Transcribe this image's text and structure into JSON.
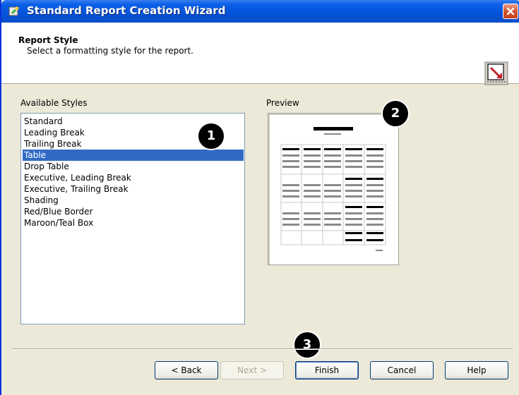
{
  "window": {
    "title": "Standard Report Creation Wizard"
  },
  "header": {
    "title": "Report Style",
    "subtitle": "Select a formatting style for the report."
  },
  "styles": {
    "label": "Available Styles",
    "items": [
      "Standard",
      "Leading Break",
      "Trailing Break",
      "Table",
      "Drop Table",
      "Executive, Leading Break",
      "Executive, Trailing Break",
      "Shading",
      "Red/Blue Border",
      "Maroon/Teal Box"
    ],
    "selected": "Table"
  },
  "preview": {
    "label": "Preview"
  },
  "callouts": {
    "one": "1",
    "two": "2",
    "three": "3"
  },
  "buttons": {
    "back": "< Back",
    "next": "Next >",
    "finish": "Finish",
    "cancel": "Cancel",
    "help": "Help"
  },
  "colors": {
    "titlebar": "#0553d9",
    "selection": "#316ac5",
    "dialog_bg": "#ece9d8"
  }
}
